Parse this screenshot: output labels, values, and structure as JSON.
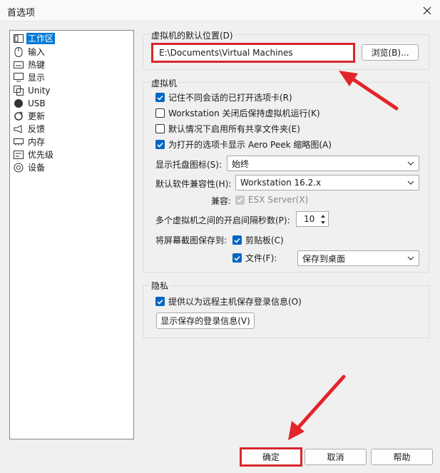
{
  "window": {
    "title": "首选项",
    "close_icon": "close-icon"
  },
  "sidebar": {
    "items": [
      {
        "label": "工作区",
        "icon": "workspace-icon",
        "selected": true
      },
      {
        "label": "输入",
        "icon": "mouse-icon"
      },
      {
        "label": "热键",
        "icon": "keyboard-icon"
      },
      {
        "label": "显示",
        "icon": "monitor-icon"
      },
      {
        "label": "Unity",
        "icon": "unity-icon"
      },
      {
        "label": "USB",
        "icon": "usb-icon"
      },
      {
        "label": "更新",
        "icon": "update-icon"
      },
      {
        "label": "反馈",
        "icon": "feedback-icon"
      },
      {
        "label": "内存",
        "icon": "memory-icon"
      },
      {
        "label": "优先级",
        "icon": "priority-icon"
      },
      {
        "label": "设备",
        "icon": "device-icon"
      }
    ]
  },
  "default_location": {
    "group_title": "虚拟机的默认位置(D)",
    "path_value": "E:\\Documents\\Virtual Machines",
    "browse_label": "浏览(B)..."
  },
  "vm": {
    "group_title": "虚拟机",
    "checkboxes": [
      {
        "label": "记住不同会话的已打开选项卡(R)",
        "checked": true
      },
      {
        "label": "Workstation 关闭后保持虚拟机运行(K)",
        "checked": false
      },
      {
        "label": "默认情况下启用所有共享文件夹(E)",
        "checked": false
      },
      {
        "label": "为打开的选项卡显示 Aero Peek 缩略图(A)",
        "checked": true
      }
    ],
    "tray_label": "显示托盘图标(S):",
    "tray_value": "始终",
    "compat_label": "默认软件兼容性(H):",
    "compat_value": "Workstation 16.2.x",
    "compat2_label": "兼容:",
    "esx_label": "ESX Server(X)",
    "interval_label": "多个虚拟机之间的开启间隔秒数(P):",
    "interval_value": "10",
    "screenshot_label": "将屏幕截图保存到:",
    "clipboard_label": "剪贴板(C)",
    "file_label": "文件(F):",
    "file_value": "保存到桌面"
  },
  "privacy": {
    "group_title": "隐私",
    "save_login_label": "提供以为远程主机保存登录信息(O)",
    "show_login_label": "显示保存的登录信息(V)"
  },
  "footer": {
    "ok_label": "确定",
    "cancel_label": "取消",
    "help_label": "帮助"
  },
  "colors": {
    "accent": "#0067c0",
    "highlight_red": "#d9262c",
    "selection": "#0078d7"
  }
}
